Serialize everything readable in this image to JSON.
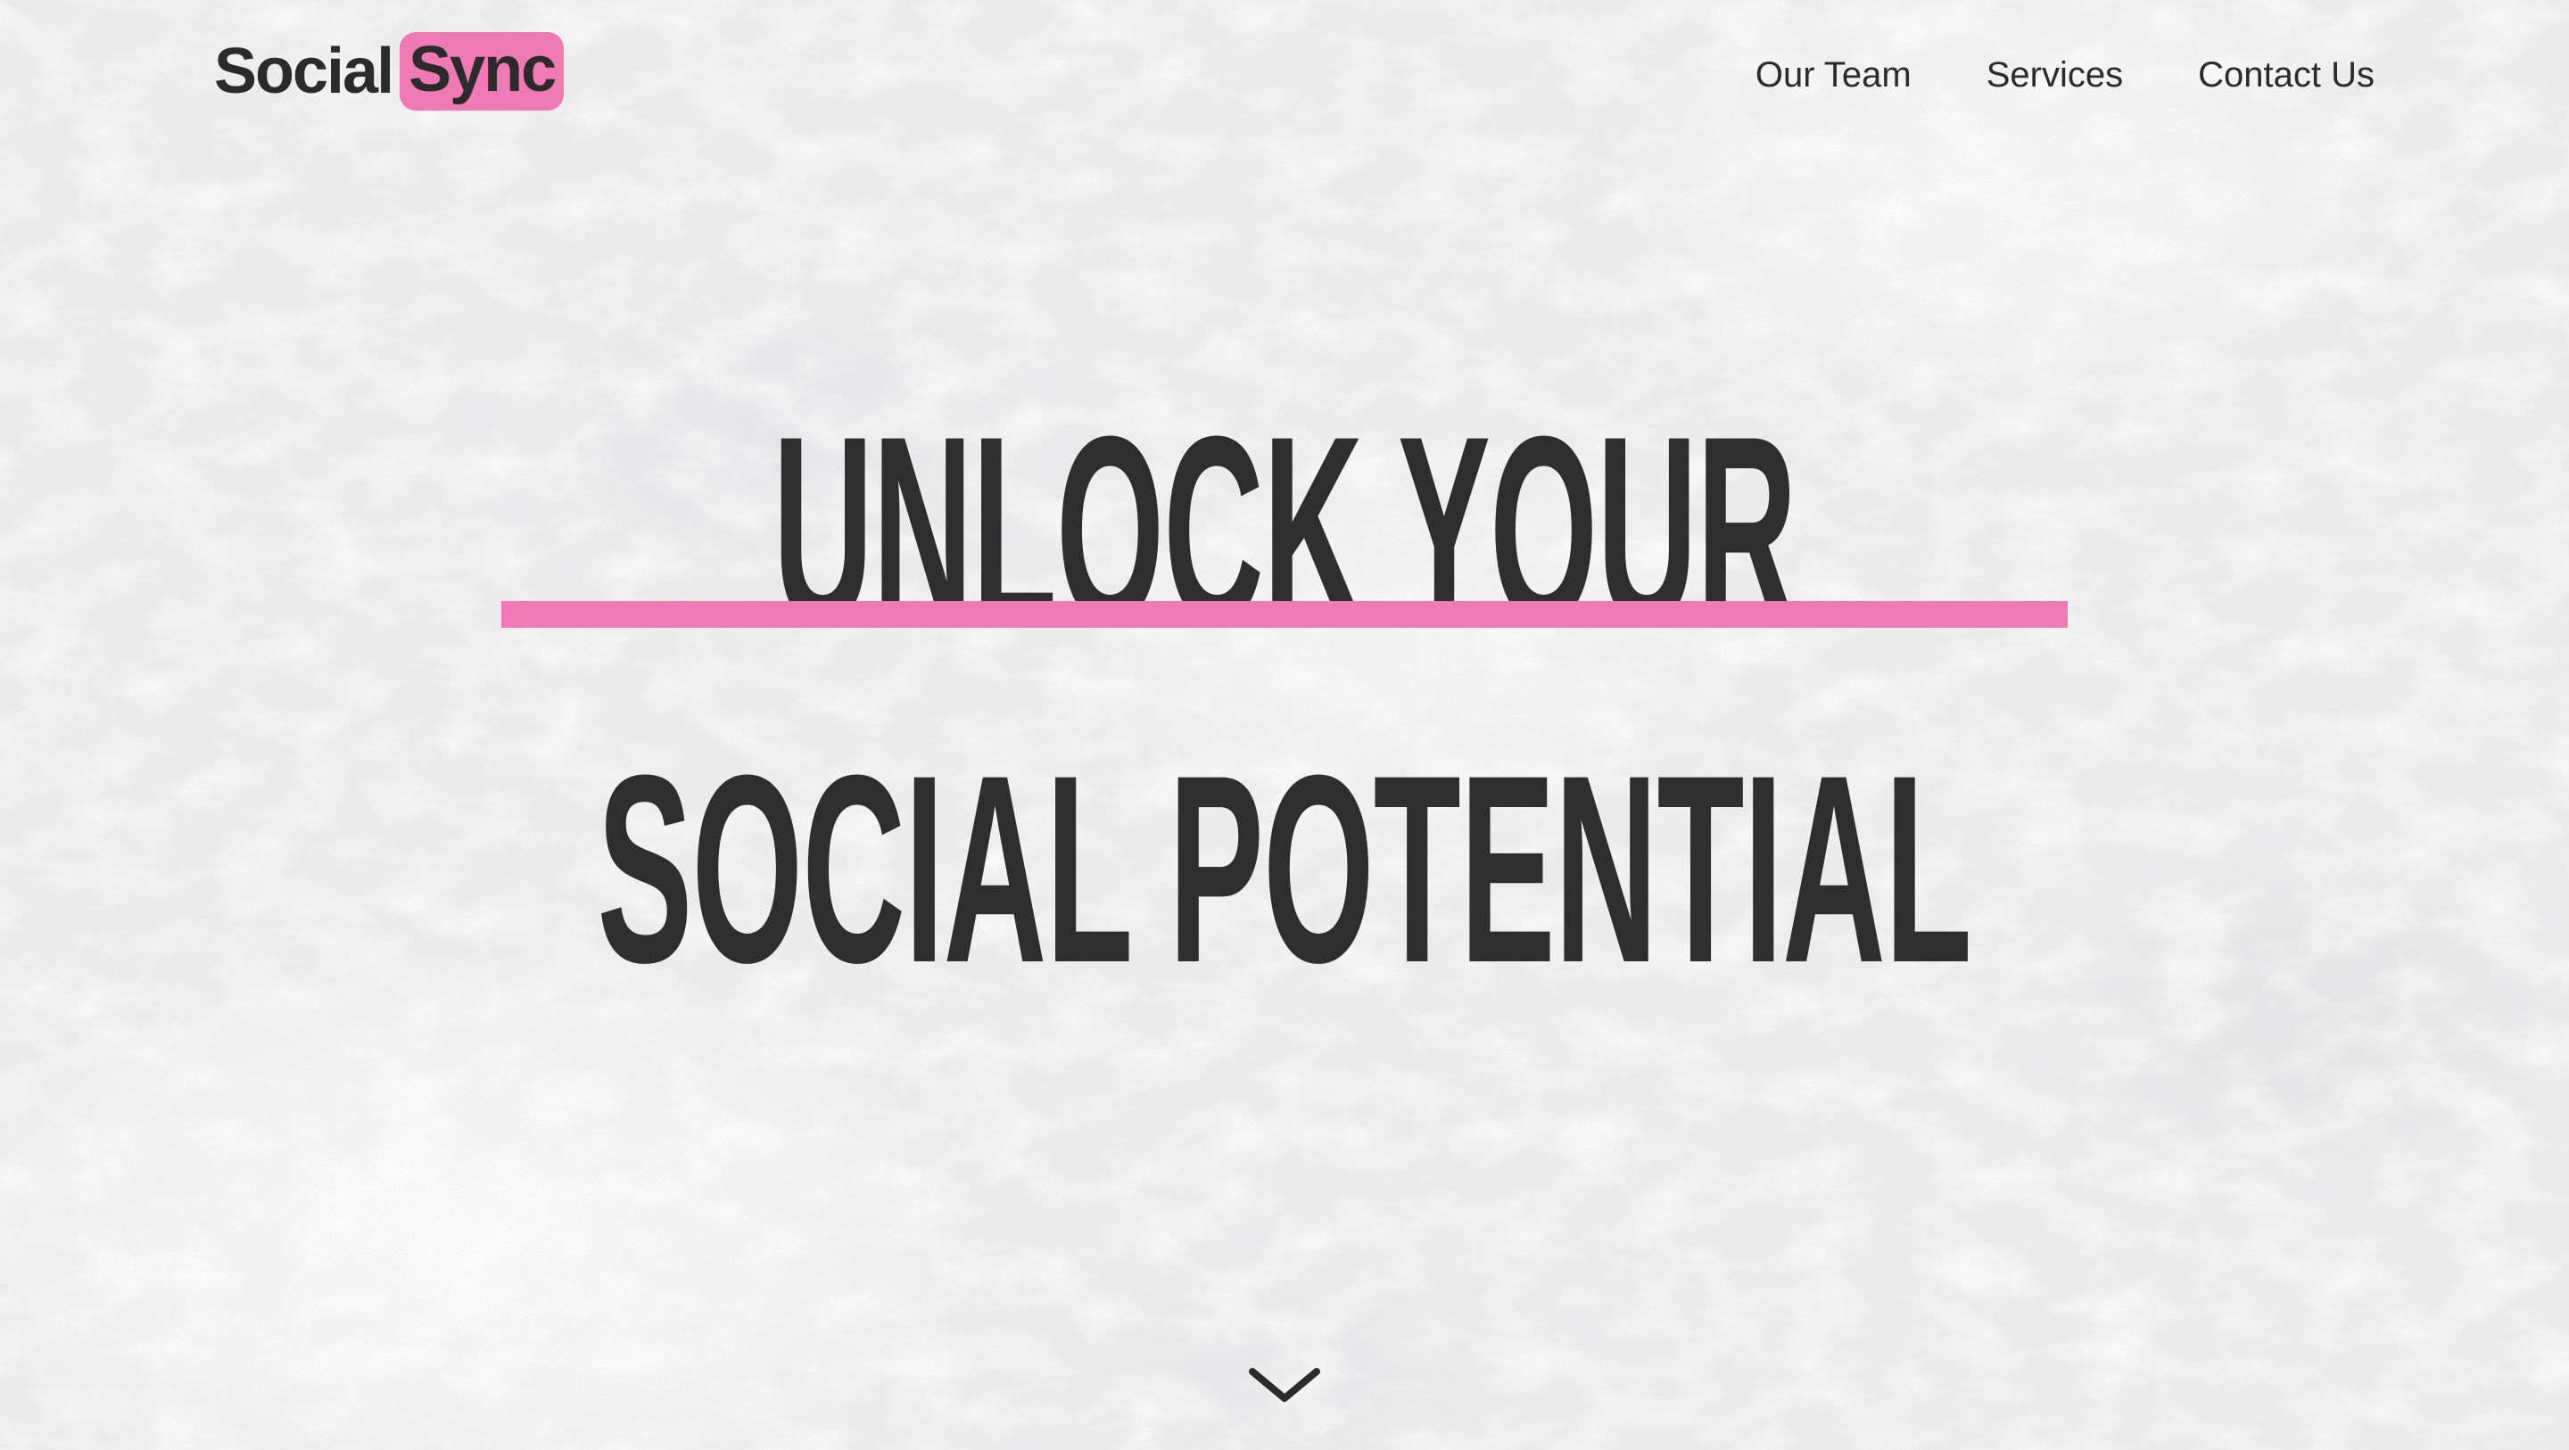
{
  "header": {
    "logo": {
      "word": "Social",
      "highlight": "Sync"
    },
    "nav": [
      {
        "label": "Our Team"
      },
      {
        "label": "Services"
      },
      {
        "label": "Contact Us"
      }
    ]
  },
  "hero": {
    "line1": "UNLOCK YOUR",
    "line2": "SOCIAL POTENTIAL"
  },
  "scroll_icon": "chevron-down-icon",
  "colors": {
    "accent": "#ef78b5",
    "text": "#2b2b2b",
    "background": "#ebebec"
  }
}
